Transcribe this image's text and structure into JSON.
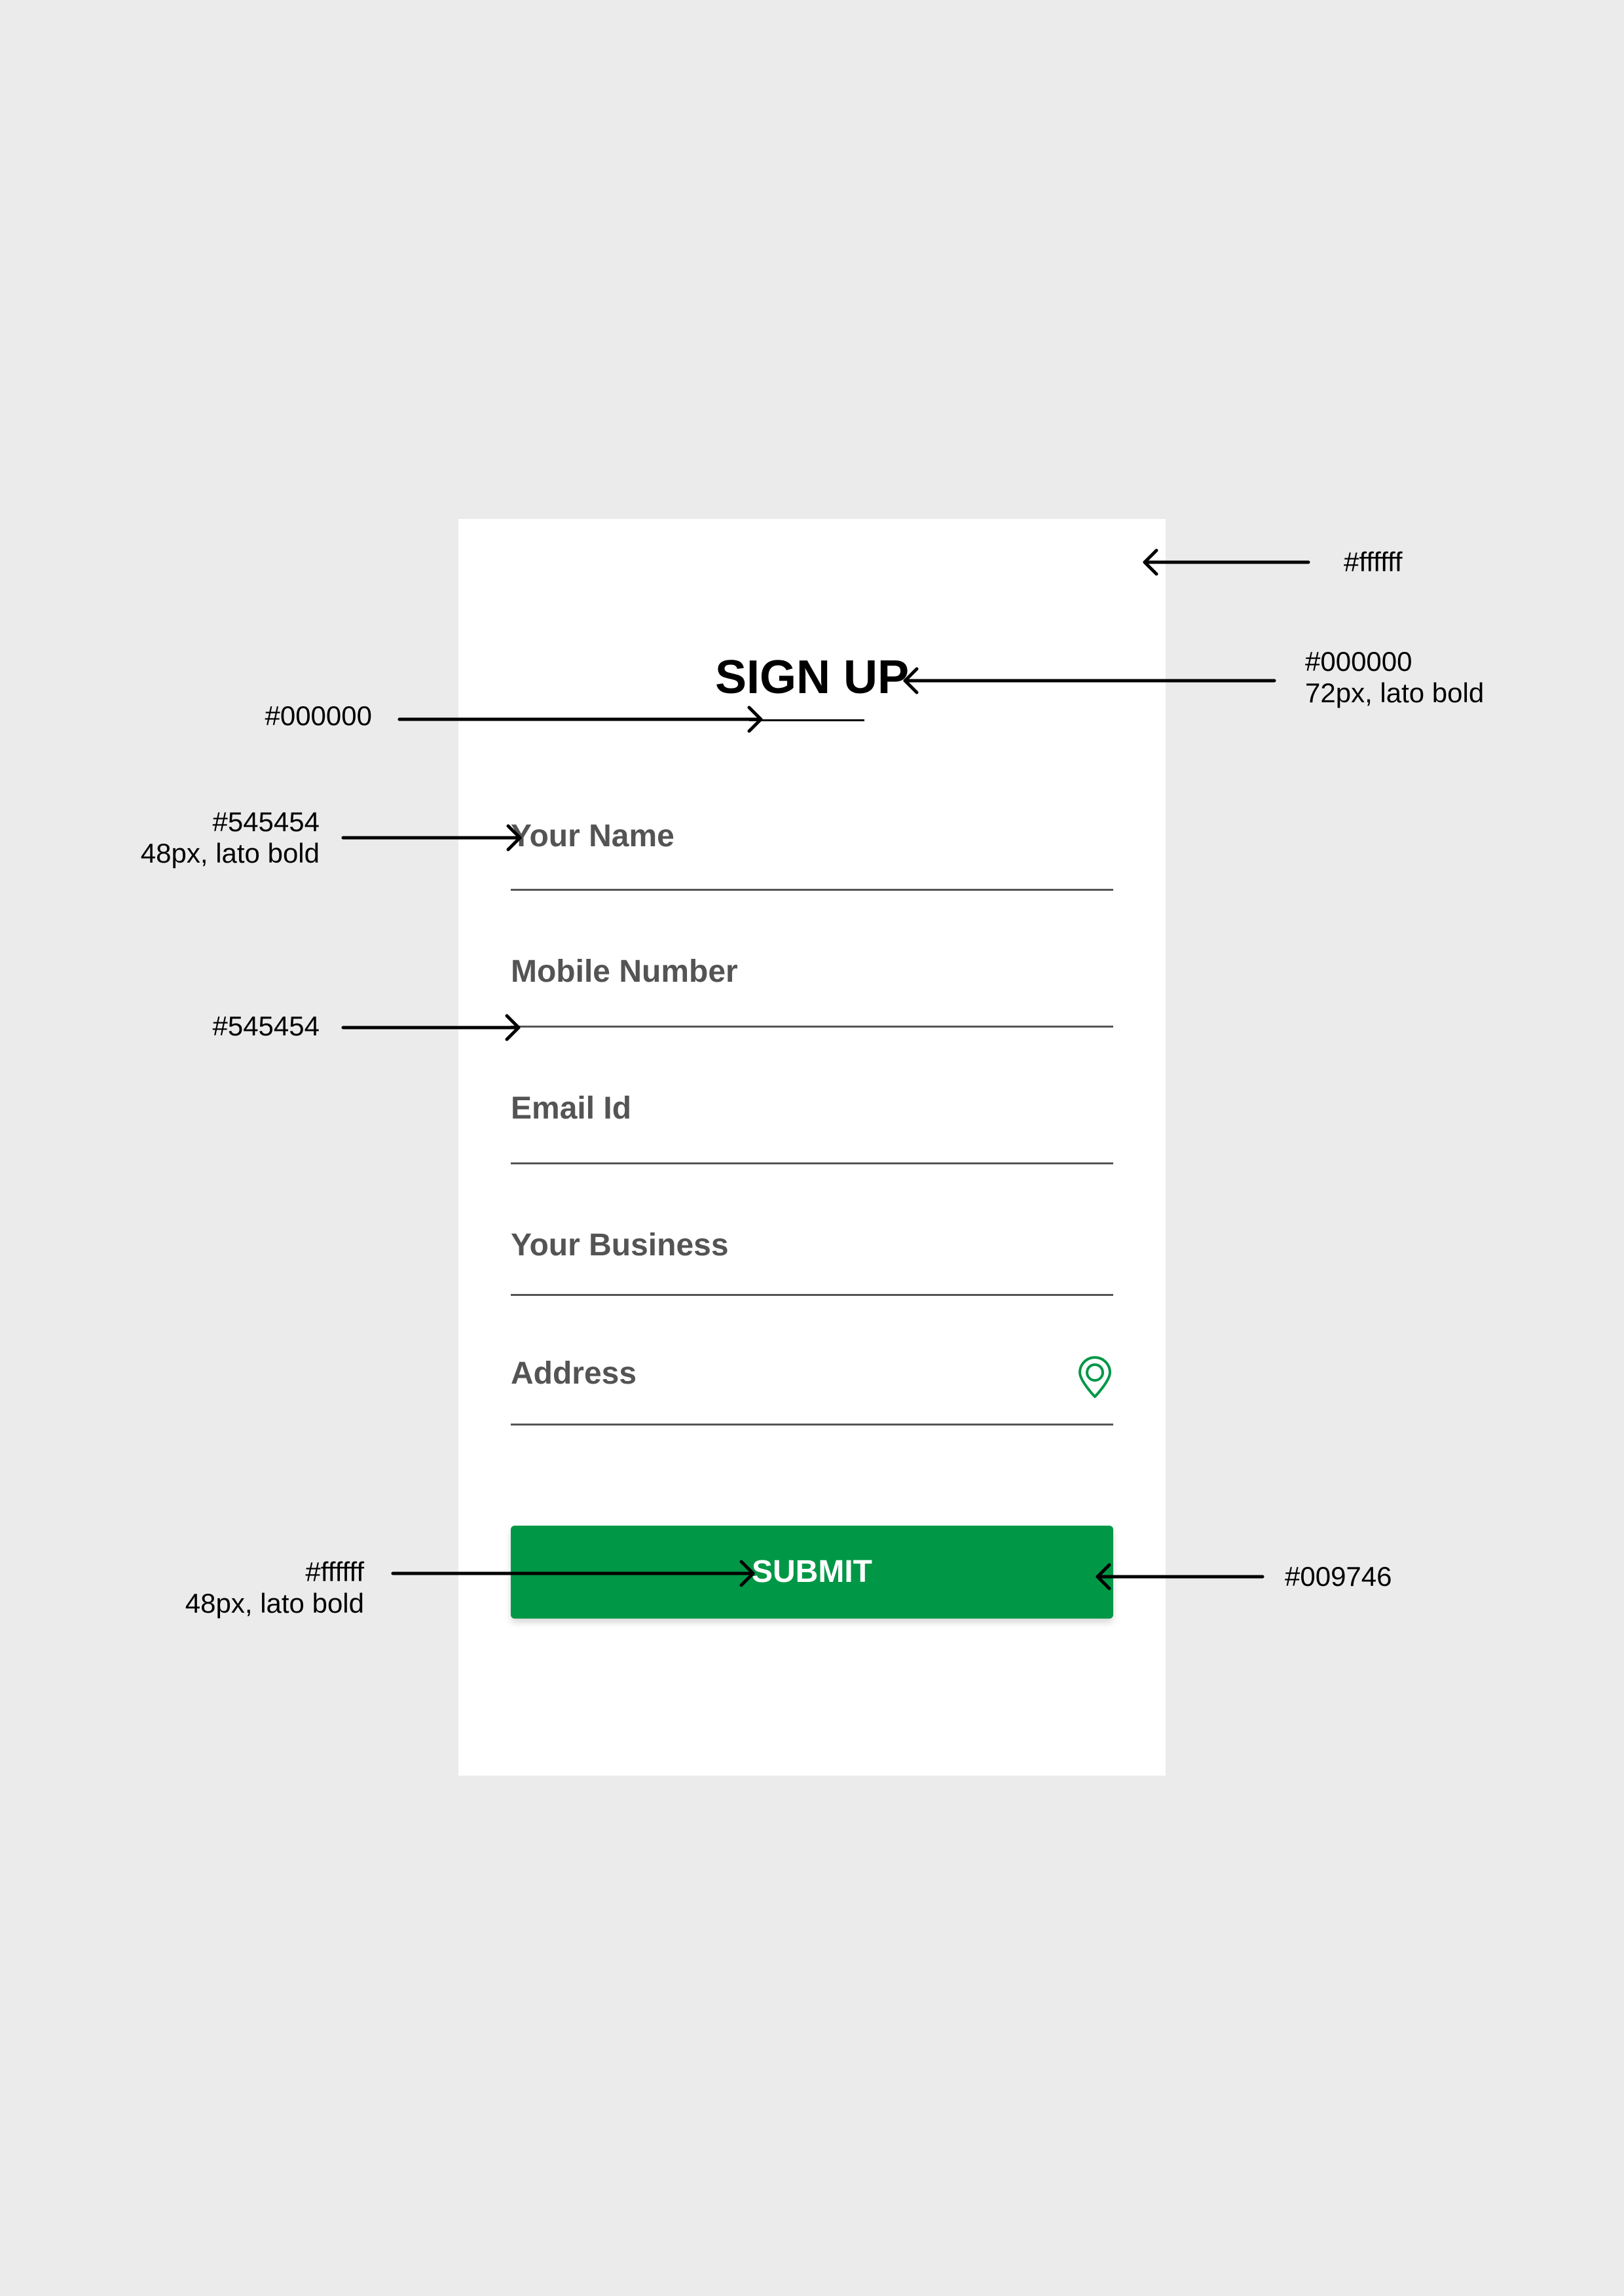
{
  "form": {
    "title": "SIGN UP",
    "fields": [
      {
        "placeholder": "Your Name",
        "icon": null
      },
      {
        "placeholder": "Mobile Number",
        "icon": null
      },
      {
        "placeholder": "Email Id",
        "icon": null
      },
      {
        "placeholder": "Your Business",
        "icon": null
      },
      {
        "placeholder": "Address",
        "icon": "location-pin-icon"
      }
    ],
    "submit_label": "SUBMIT"
  },
  "colors": {
    "background": "#ebebeb",
    "card": "#ffffff",
    "title": "#000000",
    "field_text": "#545454",
    "field_line": "#545454",
    "button": "#009746",
    "button_text": "#ffffff"
  },
  "annotations": {
    "card_bg": {
      "lines": [
        "#ffffff"
      ]
    },
    "title": {
      "lines": [
        "#000000",
        "72px, lato bold"
      ]
    },
    "title_underline": {
      "lines": [
        "#000000"
      ]
    },
    "field_text": {
      "lines": [
        "#545454",
        "48px, lato bold"
      ]
    },
    "field_line": {
      "lines": [
        "#545454"
      ]
    },
    "button_text": {
      "lines": [
        "#ffffff",
        "48px, lato bold"
      ]
    },
    "button_bg": {
      "lines": [
        "#009746"
      ]
    }
  }
}
